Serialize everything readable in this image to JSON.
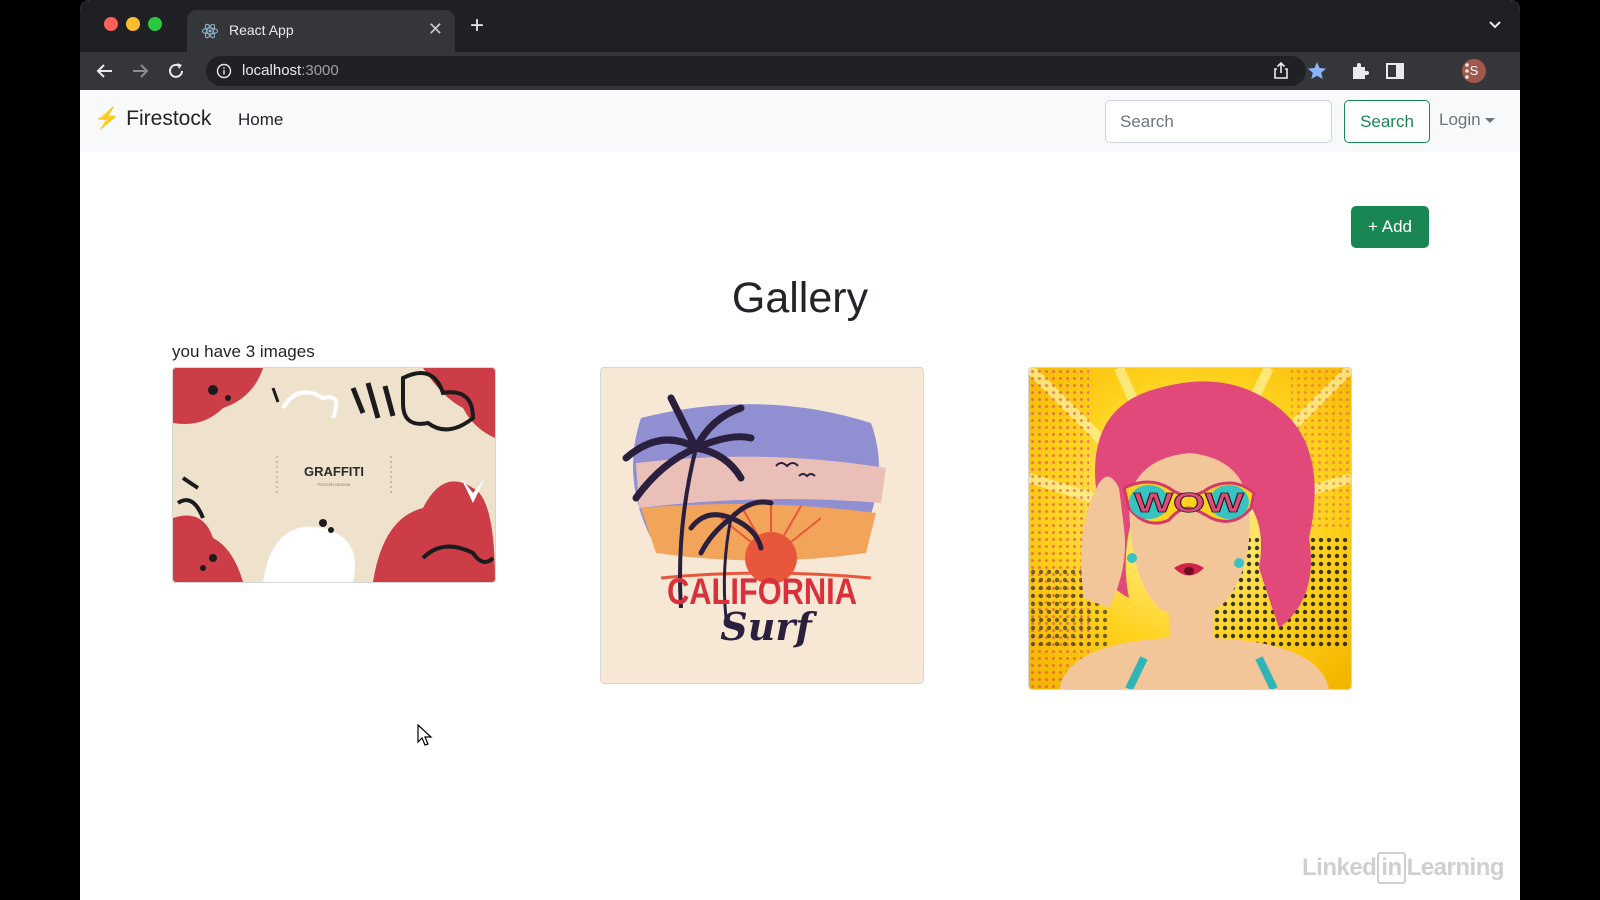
{
  "browser": {
    "tab_title": "React App",
    "tab_close": "✕",
    "new_tab": "+",
    "url_host": "localhost",
    "url_port": ":3000",
    "profile_initial": "S"
  },
  "navbar": {
    "brand_icon": "⚡",
    "brand": "Firestock",
    "home": "Home",
    "search_placeholder": "Search",
    "search_button": "Search",
    "login": "Login"
  },
  "main": {
    "add_button": "+ Add",
    "title": "Gallery",
    "image_count_text": "you have 3 images",
    "images": [
      {
        "name": "graffiti-poster",
        "caption_text": "GRAFFITI",
        "sub_text": "POSTER DESIGN"
      },
      {
        "name": "california-surf",
        "line1": "CALIFORNIA",
        "line2": "Surf"
      },
      {
        "name": "pop-art-wow",
        "text": "WOW"
      }
    ]
  },
  "watermark": {
    "left": "Linked",
    "in": "in",
    "right": "Learning"
  },
  "colors": {
    "brand_green": "#198754",
    "navbar_bg": "#f8f9fa",
    "bolt": "#f2c74b"
  }
}
